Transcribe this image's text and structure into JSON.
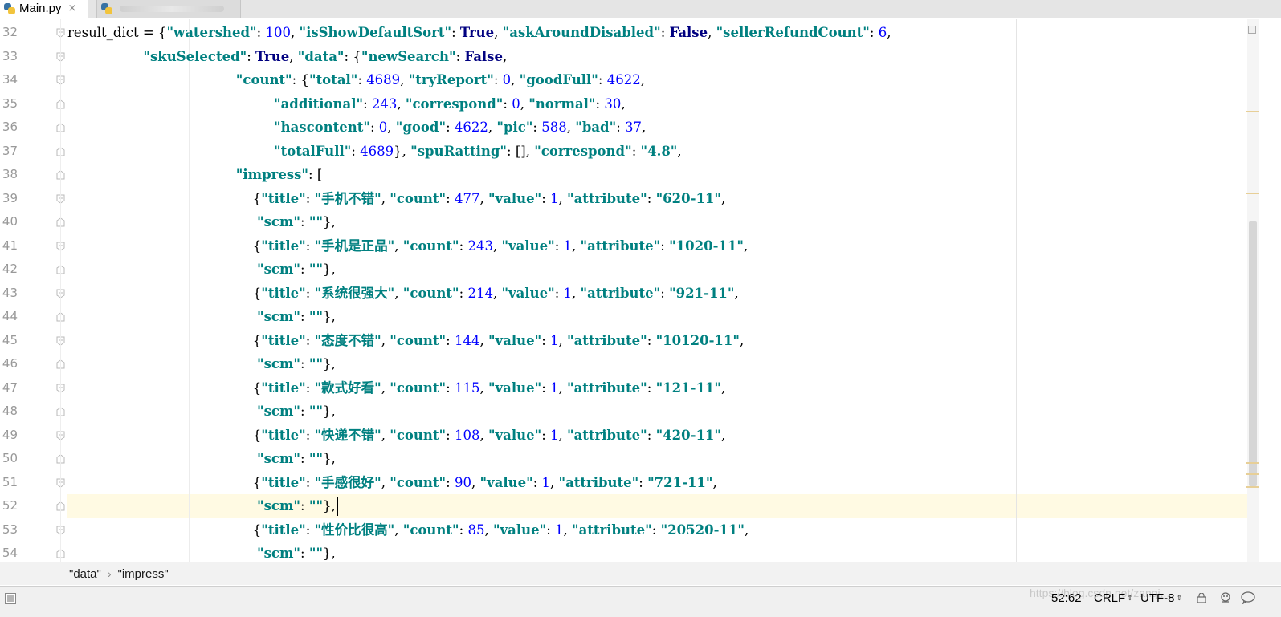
{
  "tabs": [
    {
      "label": "Main.py",
      "close": "×",
      "active": true
    },
    {
      "label": "",
      "active": false
    }
  ],
  "editor": {
    "line_numbers": [
      "32",
      "33",
      "34",
      "35",
      "36",
      "37",
      "38",
      "39",
      "40",
      "41",
      "42",
      "43",
      "44",
      "45",
      "46",
      "47",
      "48",
      "49",
      "50",
      "51",
      "52",
      "53",
      "54"
    ],
    "current_line": "52",
    "lines": [
      [
        [
          "p",
          "result_dict = {"
        ],
        [
          "s",
          "\"watershed\""
        ],
        [
          "p",
          ": "
        ],
        [
          "n",
          "100"
        ],
        [
          "p",
          ", "
        ],
        [
          "s",
          "\"isShowDefaultSort\""
        ],
        [
          "p",
          ": "
        ],
        [
          "k",
          "True"
        ],
        [
          "p",
          ", "
        ],
        [
          "s",
          "\"askAroundDisabled\""
        ],
        [
          "p",
          ": "
        ],
        [
          "k",
          "False"
        ],
        [
          "p",
          ", "
        ],
        [
          "s",
          "\"sellerRefundCount\""
        ],
        [
          "p",
          ": "
        ],
        [
          "n",
          "6"
        ],
        [
          "p",
          ","
        ]
      ],
      [
        [
          "p",
          "                  "
        ],
        [
          "s",
          "\"skuSelected\""
        ],
        [
          "p",
          ": "
        ],
        [
          "k",
          "True"
        ],
        [
          "p",
          ", "
        ],
        [
          "s",
          "\"data\""
        ],
        [
          "p",
          ": {"
        ],
        [
          "s",
          "\"newSearch\""
        ],
        [
          "p",
          ": "
        ],
        [
          "k",
          "False"
        ],
        [
          "p",
          ","
        ]
      ],
      [
        [
          "p",
          "                                        "
        ],
        [
          "s",
          "\"count\""
        ],
        [
          "p",
          ": {"
        ],
        [
          "s",
          "\"total\""
        ],
        [
          "p",
          ": "
        ],
        [
          "n",
          "4689"
        ],
        [
          "p",
          ", "
        ],
        [
          "s",
          "\"tryReport\""
        ],
        [
          "p",
          ": "
        ],
        [
          "n",
          "0"
        ],
        [
          "p",
          ", "
        ],
        [
          "s",
          "\"goodFull\""
        ],
        [
          "p",
          ": "
        ],
        [
          "n",
          "4622"
        ],
        [
          "p",
          ","
        ]
      ],
      [
        [
          "p",
          "                                                 "
        ],
        [
          "s",
          "\"additional\""
        ],
        [
          "p",
          ": "
        ],
        [
          "n",
          "243"
        ],
        [
          "p",
          ", "
        ],
        [
          "s",
          "\"correspond\""
        ],
        [
          "p",
          ": "
        ],
        [
          "n",
          "0"
        ],
        [
          "p",
          ", "
        ],
        [
          "s",
          "\"normal\""
        ],
        [
          "p",
          ": "
        ],
        [
          "n",
          "30"
        ],
        [
          "p",
          ","
        ]
      ],
      [
        [
          "p",
          "                                                 "
        ],
        [
          "s",
          "\"hascontent\""
        ],
        [
          "p",
          ": "
        ],
        [
          "n",
          "0"
        ],
        [
          "p",
          ", "
        ],
        [
          "s",
          "\"good\""
        ],
        [
          "p",
          ": "
        ],
        [
          "n",
          "4622"
        ],
        [
          "p",
          ", "
        ],
        [
          "s",
          "\"pic\""
        ],
        [
          "p",
          ": "
        ],
        [
          "n",
          "588"
        ],
        [
          "p",
          ", "
        ],
        [
          "s",
          "\"bad\""
        ],
        [
          "p",
          ": "
        ],
        [
          "n",
          "37"
        ],
        [
          "p",
          ","
        ]
      ],
      [
        [
          "p",
          "                                                 "
        ],
        [
          "s",
          "\"totalFull\""
        ],
        [
          "p",
          ": "
        ],
        [
          "n",
          "4689"
        ],
        [
          "p",
          "}, "
        ],
        [
          "s",
          "\"spuRatting\""
        ],
        [
          "p",
          ": [], "
        ],
        [
          "s",
          "\"correspond\""
        ],
        [
          "p",
          ": "
        ],
        [
          "s",
          "\"4.8\""
        ],
        [
          "p",
          ","
        ]
      ],
      [
        [
          "p",
          "                                        "
        ],
        [
          "s",
          "\"impress\""
        ],
        [
          "p",
          ": ["
        ]
      ],
      [
        [
          "p",
          "                                            {"
        ],
        [
          "s",
          "\"title\""
        ],
        [
          "p",
          ": "
        ],
        [
          "s",
          "\"手机不错\""
        ],
        [
          "p",
          ", "
        ],
        [
          "s",
          "\"count\""
        ],
        [
          "p",
          ": "
        ],
        [
          "n",
          "477"
        ],
        [
          "p",
          ", "
        ],
        [
          "s",
          "\"value\""
        ],
        [
          "p",
          ": "
        ],
        [
          "n",
          "1"
        ],
        [
          "p",
          ", "
        ],
        [
          "s",
          "\"attribute\""
        ],
        [
          "p",
          ": "
        ],
        [
          "s",
          "\"620-11\""
        ],
        [
          "p",
          ","
        ]
      ],
      [
        [
          "p",
          "                                             "
        ],
        [
          "s",
          "\"scm\""
        ],
        [
          "p",
          ": "
        ],
        [
          "s",
          "\"\""
        ],
        [
          "p",
          "},"
        ]
      ],
      [
        [
          "p",
          "                                            {"
        ],
        [
          "s",
          "\"title\""
        ],
        [
          "p",
          ": "
        ],
        [
          "s",
          "\"手机是正品\""
        ],
        [
          "p",
          ", "
        ],
        [
          "s",
          "\"count\""
        ],
        [
          "p",
          ": "
        ],
        [
          "n",
          "243"
        ],
        [
          "p",
          ", "
        ],
        [
          "s",
          "\"value\""
        ],
        [
          "p",
          ": "
        ],
        [
          "n",
          "1"
        ],
        [
          "p",
          ", "
        ],
        [
          "s",
          "\"attribute\""
        ],
        [
          "p",
          ": "
        ],
        [
          "s",
          "\"1020-11\""
        ],
        [
          "p",
          ","
        ]
      ],
      [
        [
          "p",
          "                                             "
        ],
        [
          "s",
          "\"scm\""
        ],
        [
          "p",
          ": "
        ],
        [
          "s",
          "\"\""
        ],
        [
          "p",
          "},"
        ]
      ],
      [
        [
          "p",
          "                                            {"
        ],
        [
          "s",
          "\"title\""
        ],
        [
          "p",
          ": "
        ],
        [
          "s",
          "\"系统很强大\""
        ],
        [
          "p",
          ", "
        ],
        [
          "s",
          "\"count\""
        ],
        [
          "p",
          ": "
        ],
        [
          "n",
          "214"
        ],
        [
          "p",
          ", "
        ],
        [
          "s",
          "\"value\""
        ],
        [
          "p",
          ": "
        ],
        [
          "n",
          "1"
        ],
        [
          "p",
          ", "
        ],
        [
          "s",
          "\"attribute\""
        ],
        [
          "p",
          ": "
        ],
        [
          "s",
          "\"921-11\""
        ],
        [
          "p",
          ","
        ]
      ],
      [
        [
          "p",
          "                                             "
        ],
        [
          "s",
          "\"scm\""
        ],
        [
          "p",
          ": "
        ],
        [
          "s",
          "\"\""
        ],
        [
          "p",
          "},"
        ]
      ],
      [
        [
          "p",
          "                                            {"
        ],
        [
          "s",
          "\"title\""
        ],
        [
          "p",
          ": "
        ],
        [
          "s",
          "\"态度不错\""
        ],
        [
          "p",
          ", "
        ],
        [
          "s",
          "\"count\""
        ],
        [
          "p",
          ": "
        ],
        [
          "n",
          "144"
        ],
        [
          "p",
          ", "
        ],
        [
          "s",
          "\"value\""
        ],
        [
          "p",
          ": "
        ],
        [
          "n",
          "1"
        ],
        [
          "p",
          ", "
        ],
        [
          "s",
          "\"attribute\""
        ],
        [
          "p",
          ": "
        ],
        [
          "s",
          "\"10120-11\""
        ],
        [
          "p",
          ","
        ]
      ],
      [
        [
          "p",
          "                                             "
        ],
        [
          "s",
          "\"scm\""
        ],
        [
          "p",
          ": "
        ],
        [
          "s",
          "\"\""
        ],
        [
          "p",
          "},"
        ]
      ],
      [
        [
          "p",
          "                                            {"
        ],
        [
          "s",
          "\"title\""
        ],
        [
          "p",
          ": "
        ],
        [
          "s",
          "\"款式好看\""
        ],
        [
          "p",
          ", "
        ],
        [
          "s",
          "\"count\""
        ],
        [
          "p",
          ": "
        ],
        [
          "n",
          "115"
        ],
        [
          "p",
          ", "
        ],
        [
          "s",
          "\"value\""
        ],
        [
          "p",
          ": "
        ],
        [
          "n",
          "1"
        ],
        [
          "p",
          ", "
        ],
        [
          "s",
          "\"attribute\""
        ],
        [
          "p",
          ": "
        ],
        [
          "s",
          "\"121-11\""
        ],
        [
          "p",
          ","
        ]
      ],
      [
        [
          "p",
          "                                             "
        ],
        [
          "s",
          "\"scm\""
        ],
        [
          "p",
          ": "
        ],
        [
          "s",
          "\"\""
        ],
        [
          "p",
          "},"
        ]
      ],
      [
        [
          "p",
          "                                            {"
        ],
        [
          "s",
          "\"title\""
        ],
        [
          "p",
          ": "
        ],
        [
          "s",
          "\"快递不错\""
        ],
        [
          "p",
          ", "
        ],
        [
          "s",
          "\"count\""
        ],
        [
          "p",
          ": "
        ],
        [
          "n",
          "108"
        ],
        [
          "p",
          ", "
        ],
        [
          "s",
          "\"value\""
        ],
        [
          "p",
          ": "
        ],
        [
          "n",
          "1"
        ],
        [
          "p",
          ", "
        ],
        [
          "s",
          "\"attribute\""
        ],
        [
          "p",
          ": "
        ],
        [
          "s",
          "\"420-11\""
        ],
        [
          "p",
          ","
        ]
      ],
      [
        [
          "p",
          "                                             "
        ],
        [
          "s",
          "\"scm\""
        ],
        [
          "p",
          ": "
        ],
        [
          "s",
          "\"\""
        ],
        [
          "p",
          "},"
        ]
      ],
      [
        [
          "p",
          "                                            {"
        ],
        [
          "s",
          "\"title\""
        ],
        [
          "p",
          ": "
        ],
        [
          "s",
          "\"手感很好\""
        ],
        [
          "p",
          ", "
        ],
        [
          "s",
          "\"count\""
        ],
        [
          "p",
          ": "
        ],
        [
          "n",
          "90"
        ],
        [
          "p",
          ", "
        ],
        [
          "s",
          "\"value\""
        ],
        [
          "p",
          ": "
        ],
        [
          "n",
          "1"
        ],
        [
          "p",
          ", "
        ],
        [
          "s",
          "\"attribute\""
        ],
        [
          "p",
          ": "
        ],
        [
          "s",
          "\"721-11\""
        ],
        [
          "p",
          ","
        ]
      ],
      [
        [
          "p",
          "                                             "
        ],
        [
          "s",
          "\"scm\""
        ],
        [
          "p",
          ": "
        ],
        [
          "s",
          "\"\""
        ],
        [
          "p",
          "},"
        ]
      ],
      [
        [
          "p",
          "                                            {"
        ],
        [
          "s",
          "\"title\""
        ],
        [
          "p",
          ": "
        ],
        [
          "s",
          "\"性价比很高\""
        ],
        [
          "p",
          ", "
        ],
        [
          "s",
          "\"count\""
        ],
        [
          "p",
          ": "
        ],
        [
          "n",
          "85"
        ],
        [
          "p",
          ", "
        ],
        [
          "s",
          "\"value\""
        ],
        [
          "p",
          ": "
        ],
        [
          "n",
          "1"
        ],
        [
          "p",
          ", "
        ],
        [
          "s",
          "\"attribute\""
        ],
        [
          "p",
          ": "
        ],
        [
          "s",
          "\"20520-11\""
        ],
        [
          "p",
          ","
        ]
      ],
      [
        [
          "p",
          "                                             "
        ],
        [
          "s",
          "\"scm\""
        ],
        [
          "p",
          ": "
        ],
        [
          "s",
          "\"\""
        ],
        [
          "p",
          "},"
        ]
      ]
    ]
  },
  "breadcrumb": {
    "items": [
      "\"data\"",
      "\"impress\""
    ],
    "separator": "›"
  },
  "status_bar": {
    "watermark": "https://blog.csdn.net/zangj...",
    "caret_position": "52:62",
    "line_separator": "CRLF",
    "encoding": "UTF-8",
    "icons": [
      "lock-icon",
      "inspector-icon",
      "notifications-icon"
    ]
  },
  "colors": {
    "keyword": "#000080",
    "string": "#008080",
    "number": "#0000ff",
    "current_line": "#fffae3"
  }
}
